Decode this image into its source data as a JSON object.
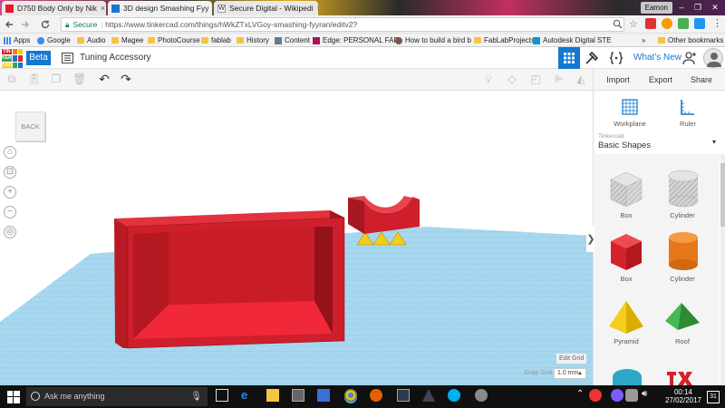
{
  "browser": {
    "tabs": [
      {
        "title": "D750 Body Only by Nik",
        "favicon_color": "#e6192a",
        "active": false
      },
      {
        "title": "3D design Smashing Fyy",
        "favicon_color": "#1477d1",
        "active": true
      },
      {
        "title": "Secure Digital - Wikipedi",
        "favicon_color": "#ffffff",
        "active": false
      }
    ],
    "tab_close": "×",
    "user_name": "Eamon",
    "window_controls": [
      "–",
      "❐",
      "✕"
    ],
    "secure_label": "Secure",
    "url": "https://www.tinkercad.com/things/hWkZTxLVGoy-smashing-fyyran/editv2?",
    "bookmarks": [
      "Apps",
      "Google",
      "Audio",
      "Magee",
      "PhotoCourse",
      "fablab",
      "History",
      "Content",
      "Edge: PERSONAL FAR",
      "How to build a bird b",
      "FabLabProjects",
      "Autodesk Digital STE",
      "Other bookmarks"
    ],
    "bookmarks_overflow": "»"
  },
  "app": {
    "logo_letters": [
      "TIN",
      "KER",
      "CAD"
    ],
    "beta_label": "Beta",
    "design_title": "Tuning Accessory",
    "whats_new": "What's New",
    "import_label": "Import",
    "export_label": "Export",
    "share_label": "Share",
    "back_label": "BACK",
    "edit_grid_label": "Edit Grid",
    "snap_grid_label": "Snap Grid",
    "snap_grid_value": "1.0 mm",
    "snap_caret": "▲",
    "nav_home": "⌂",
    "nav_fit": "⊡",
    "nav_zoom_in": "+",
    "nav_zoom_out": "−",
    "nav_perspective": "◎",
    "collapse_icon": "❯"
  },
  "panel": {
    "workplane_label": "Workplane",
    "ruler_label": "Ruler",
    "library_small": "Tinkercad",
    "library_selected": "Basic Shapes",
    "library_caret": "▾",
    "shapes": [
      {
        "name": "Box",
        "color": "#c9c9c9"
      },
      {
        "name": "Cylinder",
        "color": "#c9c9c9"
      },
      {
        "name": "Box",
        "color": "#e0242c"
      },
      {
        "name": "Cylinder",
        "color": "#f07f1a"
      },
      {
        "name": "Pyramid",
        "color": "#f6cd1c"
      },
      {
        "name": "Roof",
        "color": "#3aa742"
      }
    ]
  },
  "taskbar": {
    "search_placeholder": "Ask me anything",
    "time": "00:14",
    "date": "27/02/2017",
    "notification_count": "31"
  },
  "colors": {
    "accent": "#1477d1",
    "workplane": "#9fd3ec",
    "shape_red": "#d21f2d"
  }
}
